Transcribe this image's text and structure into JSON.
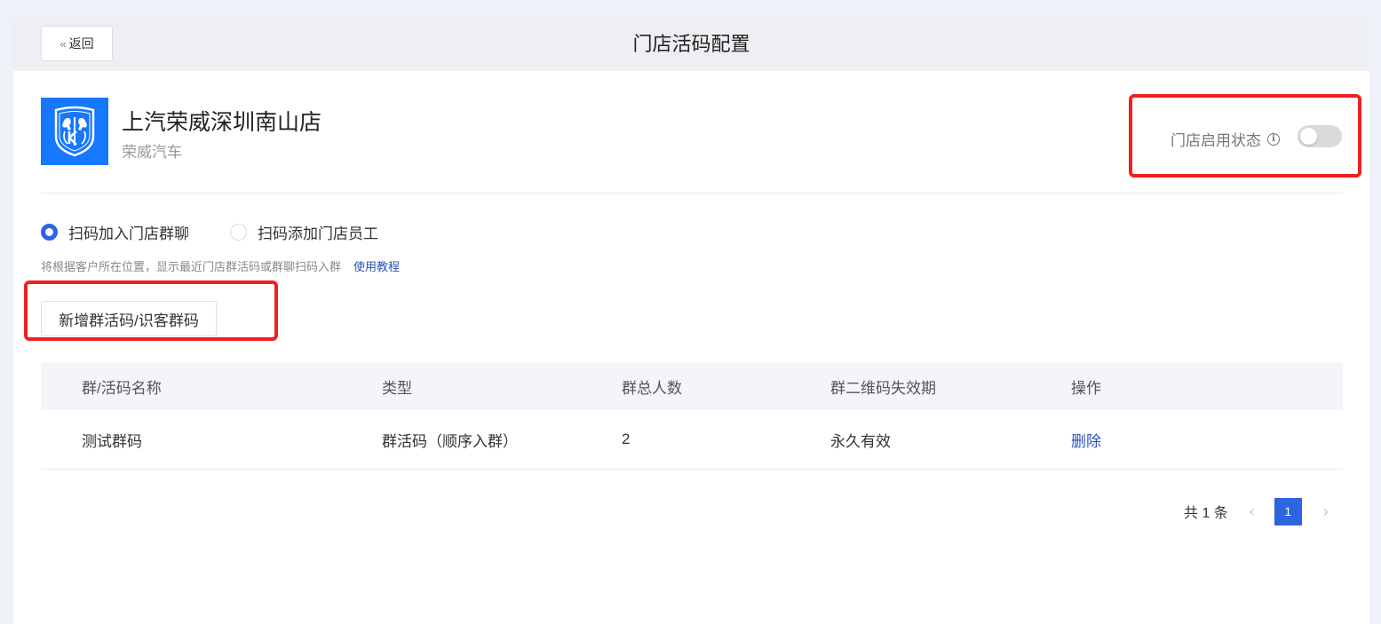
{
  "header": {
    "back_label": "返回",
    "title": "门店活码配置"
  },
  "store": {
    "name": "上汽荣威深圳南山店",
    "brand": "荣威汽车",
    "logo_icon": "roewe-lion-shield-logo",
    "status_label": "门店启用状态",
    "status_enabled": false
  },
  "mode": {
    "options": [
      {
        "label": "扫码加入门店群聊",
        "selected": true
      },
      {
        "label": "扫码添加门店员工",
        "selected": false
      }
    ],
    "hint": "将根据客户所在位置，显示最近门店群活码或群聊扫码入群",
    "tutorial_link": "使用教程"
  },
  "actions": {
    "add_label": "新增群活码/识客群码"
  },
  "table": {
    "columns": [
      "群/活码名称",
      "类型",
      "群总人数",
      "群二维码失效期",
      "操作"
    ],
    "rows": [
      {
        "name": "测试群码",
        "type": "群活码（顺序入群）",
        "members": "2",
        "expiry": "永久有效",
        "action": "删除"
      }
    ]
  },
  "pagination": {
    "total_text": "共 1 条",
    "current_page": "1"
  },
  "colors": {
    "accent": "#2b65e0",
    "link": "#2a54b5",
    "highlight": "#f0201f",
    "logo_bg": "#1677ff"
  }
}
